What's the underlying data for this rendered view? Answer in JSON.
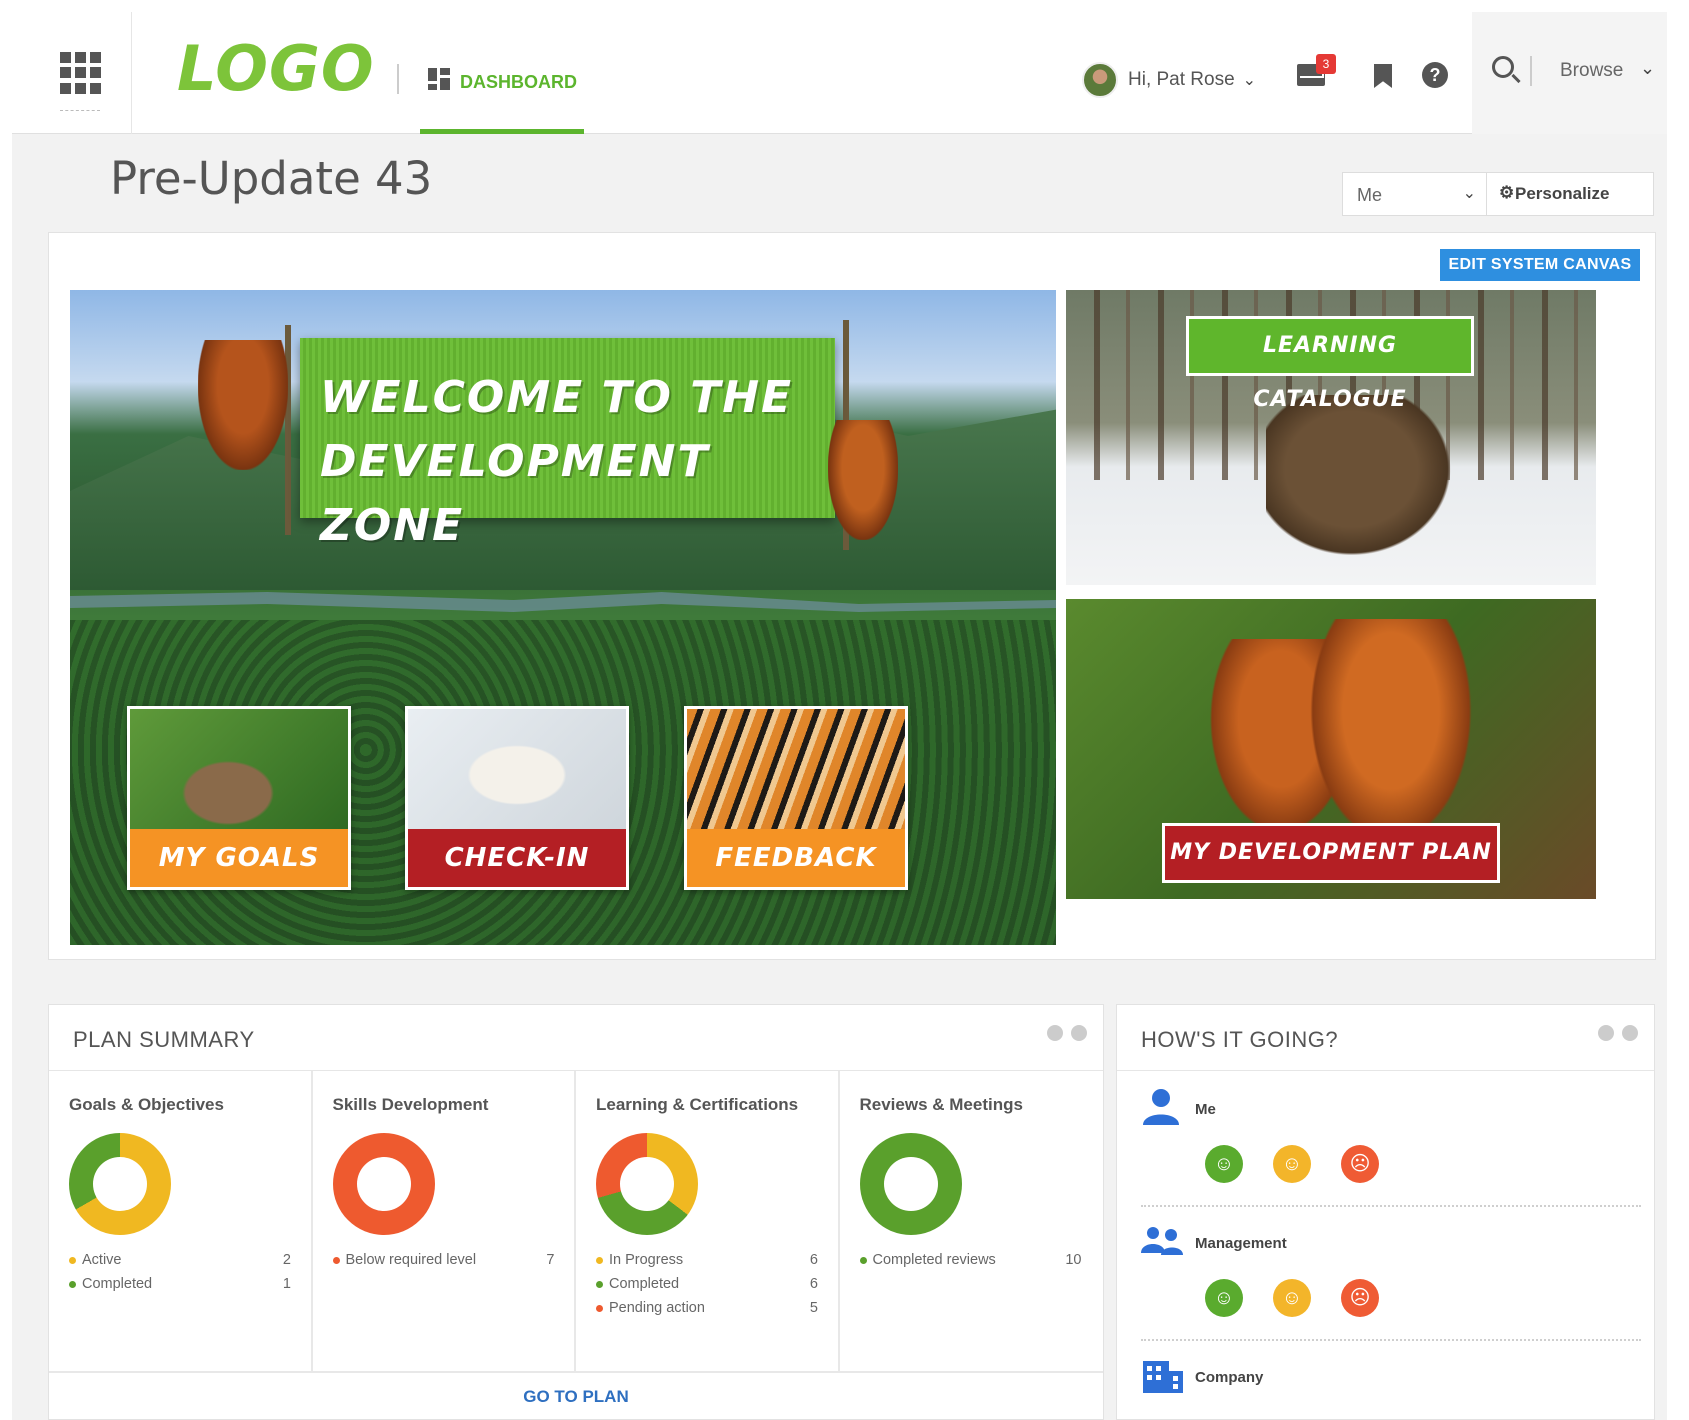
{
  "header": {
    "logo_text": "LOGO",
    "dashboard_tab": "DASHBOARD",
    "greeting": "Hi, Pat Rose",
    "mail_badge": "3",
    "browse_label": "Browse"
  },
  "page": {
    "title": "Pre-Update 43",
    "scope_select_value": "Me",
    "personalize_label": "Personalize",
    "edit_canvas_label": "EDIT SYSTEM CANVAS"
  },
  "canvas": {
    "banner_line1": "WELCOME TO THE",
    "banner_line2": "DEVELOPMENT ZONE",
    "tiles": [
      {
        "label": "MY GOALS"
      },
      {
        "label": "CHECK-IN"
      },
      {
        "label": "FEEDBACK"
      }
    ],
    "learning_catalogue": "LEARNING CATALOGUE",
    "development_plan": "MY DEVELOPMENT PLAN"
  },
  "plan_summary": {
    "title": "PLAN SUMMARY",
    "footer_link": "GO TO PLAN",
    "colors": {
      "yellow": "#f0b821",
      "green": "#5aa02c",
      "red": "#ee5a2f"
    },
    "columns": [
      {
        "title": "Goals & Objectives",
        "items": [
          {
            "name": "Active",
            "value": "2",
            "color": "#f0b821"
          },
          {
            "name": "Completed",
            "value": "1",
            "color": "#5aa02c"
          }
        ]
      },
      {
        "title": "Skills Development",
        "items": [
          {
            "name": "Below required level",
            "value": "7",
            "color": "#ee5a2f"
          }
        ]
      },
      {
        "title": "Learning & Certifications",
        "items": [
          {
            "name": "In Progress",
            "value": "6",
            "color": "#f0b821"
          },
          {
            "name": "Completed",
            "value": "6",
            "color": "#5aa02c"
          },
          {
            "name": "Pending action",
            "value": "5",
            "color": "#ee5a2f"
          }
        ]
      },
      {
        "title": "Reviews & Meetings",
        "items": [
          {
            "name": "Completed reviews",
            "value": "10",
            "color": "#5aa02c"
          }
        ]
      }
    ]
  },
  "hows_it_going": {
    "title": "HOW'S IT GOING?",
    "sections": [
      {
        "label": "Me",
        "icon": "person-icon"
      },
      {
        "label": "Management",
        "icon": "people-icon"
      },
      {
        "label": "Company",
        "icon": "building-icon"
      }
    ],
    "faces": [
      "happy-face-icon",
      "neutral-face-icon",
      "sad-face-icon"
    ]
  }
}
